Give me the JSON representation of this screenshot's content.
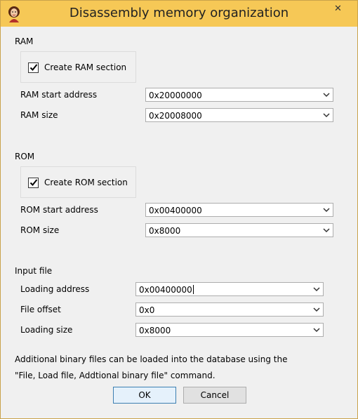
{
  "window": {
    "title": "Disassembly memory organization",
    "close_glyph": "✕",
    "icon": "app-portrait-icon"
  },
  "ram": {
    "group_label": "RAM",
    "create_label": "Create RAM section",
    "create_checked": true,
    "start_label": "RAM start address",
    "start_value": "0x20000000",
    "size_label": "RAM size",
    "size_value": "0x20008000"
  },
  "rom": {
    "group_label": "ROM",
    "create_label": "Create ROM section",
    "create_checked": true,
    "start_label": "ROM start address",
    "start_value": "0x00400000",
    "size_label": "ROM size",
    "size_value": "0x8000"
  },
  "input_file": {
    "group_label": "Input file",
    "loading_address_label": "Loading address",
    "loading_address_value": "0x00400000",
    "file_offset_label": "File offset",
    "file_offset_value": "0x0",
    "loading_size_label": "Loading size",
    "loading_size_value": "0x8000"
  },
  "note": {
    "line1": "Additional binary files can be loaded into the database using the",
    "line2": "\"File, Load file, Addtional binary file\" command."
  },
  "buttons": {
    "ok": "OK",
    "cancel": "Cancel"
  },
  "colors": {
    "titlebar": "#f6c856",
    "window_bg": "#f0f0f0",
    "default_button_border": "#3c7fb1"
  }
}
